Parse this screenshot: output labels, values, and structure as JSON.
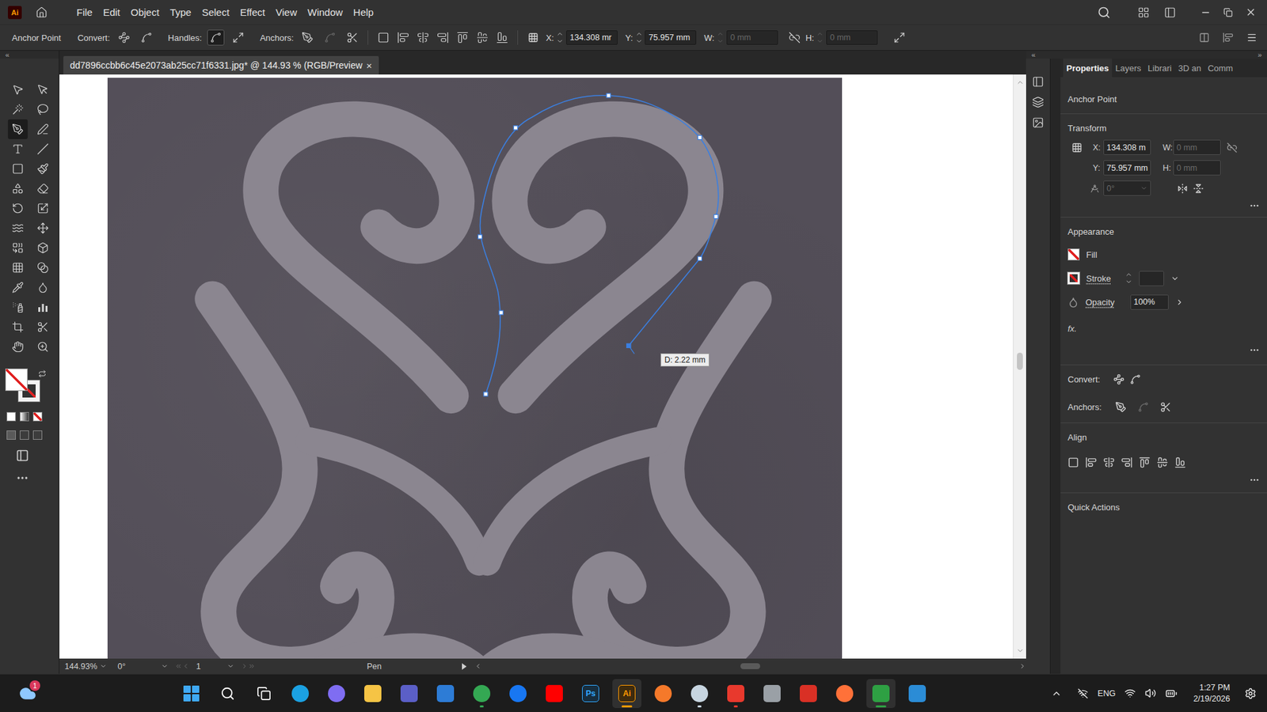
{
  "app": {
    "logo": "Ai"
  },
  "menu": [
    "File",
    "Edit",
    "Object",
    "Type",
    "Select",
    "Effect",
    "View",
    "Window",
    "Help"
  ],
  "control_bar": {
    "tool_name": "Anchor Point",
    "convert_label": "Convert:",
    "handles_label": "Handles:",
    "anchors_label": "Anchors:",
    "handles": [
      {
        "selected": true
      },
      {
        "selected": false
      }
    ],
    "anchor_buttons": [
      {
        "disabled": false
      },
      {
        "disabled": true
      },
      {
        "disabled": false
      }
    ],
    "fields": [
      {
        "label": "X:",
        "value": "134.308 mr",
        "disabled": false
      },
      {
        "label": "Y:",
        "value": "75.957 mm",
        "disabled": false
      },
      {
        "label": "W:",
        "value": "0 mm",
        "disabled": true
      },
      {
        "label": "H:",
        "value": "0 mm",
        "disabled": true
      }
    ]
  },
  "panel_toggles": {
    "toolbar_collapse": "«",
    "panels_collapse": "«",
    "panels_expand": "»"
  },
  "toolbar": {
    "tools": [
      {
        "selected": false
      },
      {
        "selected": false
      },
      {
        "selected": false
      },
      {
        "selected": false
      },
      {
        "selected": true
      },
      {
        "selected": false
      },
      {
        "selected": false
      },
      {
        "selected": false
      },
      {
        "selected": false
      },
      {
        "selected": false
      },
      {
        "selected": false
      },
      {
        "selected": false
      },
      {
        "selected": false
      },
      {
        "selected": false
      },
      {
        "selected": false
      },
      {
        "selected": false
      },
      {
        "selected": false
      },
      {
        "selected": false
      },
      {
        "selected": false
      },
      {
        "selected": false
      },
      {
        "selected": false
      },
      {
        "selected": false
      },
      {
        "selected": false
      },
      {
        "selected": false
      },
      {
        "selected": false
      },
      {
        "selected": false
      },
      {
        "selected": false
      },
      {
        "selected": false
      }
    ]
  },
  "document": {
    "tab_title": "dd7896ccbb6c45e2073ab25cc71f6331.jpg* @ 144.93 % (RGB/Preview",
    "close": "×",
    "measure_tooltip": "D: 2.22 mm",
    "h_scroll_level": 0.5,
    "v_scroll_level": 0.49
  },
  "panel_tabs": [
    {
      "label": "Properties",
      "selected": true
    },
    {
      "label": "Layers",
      "selected": false
    },
    {
      "label": "Librari",
      "selected": false
    },
    {
      "label": "3D an",
      "selected": false
    },
    {
      "label": "Comm",
      "selected": false
    }
  ],
  "properties": {
    "selection": "Anchor Point",
    "transform": {
      "title": "Transform",
      "fields": [
        {
          "label": "X:",
          "value": "134.308 m",
          "disabled": false
        },
        {
          "label": "W:",
          "value": "0 mm",
          "disabled": true
        },
        {
          "label": "Y:",
          "value": "75.957 mm",
          "disabled": false
        },
        {
          "label": "H:",
          "value": "0 mm",
          "disabled": true
        }
      ],
      "angle": {
        "value": "0°",
        "disabled": true
      }
    },
    "appearance": {
      "title": "Appearance",
      "fill": "Fill",
      "stroke": "Stroke",
      "opacity_label": "Opacity",
      "opacity_value": "100%",
      "effects": "fx."
    },
    "convert_label": "Convert:",
    "anchors_label": "Anchors:",
    "anchor_buttons": [
      {
        "disabled": false
      },
      {
        "disabled": true
      },
      {
        "disabled": false
      }
    ],
    "align_title": "Align",
    "quick_actions_title": "Quick Actions"
  },
  "status_bar": {
    "zoom": "144.93%",
    "rotation": "0°",
    "artboard": "1",
    "tool": "Pen"
  },
  "taskbar": {
    "weather_badge": "1",
    "apps": [
      {
        "kind": "windows",
        "color": "#3fa9f5",
        "label": "",
        "selected": false,
        "running": false
      },
      {
        "kind": "search",
        "color": "#ffffff",
        "label": "",
        "selected": false,
        "running": false
      },
      {
        "kind": "taskview",
        "color": "#ffffff",
        "label": "",
        "selected": false,
        "running": false
      },
      {
        "kind": "circle",
        "color": "#1ba1e2",
        "label": "",
        "selected": false,
        "running": false
      },
      {
        "kind": "circle",
        "color": "#7f6df2",
        "label": "",
        "selected": false,
        "running": false
      },
      {
        "kind": "tile",
        "color": "#f6c445",
        "label": "",
        "selected": false,
        "running": false
      },
      {
        "kind": "tile",
        "color": "#5b5fc7",
        "label": "",
        "selected": false,
        "running": false
      },
      {
        "kind": "tile",
        "color": "#2d7cd6",
        "label": "",
        "selected": false,
        "running": false
      },
      {
        "kind": "circle",
        "color": "#34a853",
        "label": "",
        "selected": false,
        "running": true
      },
      {
        "kind": "circle",
        "color": "#1877f2",
        "label": "",
        "selected": false,
        "running": false
      },
      {
        "kind": "tile",
        "color": "#ff0000",
        "label": "",
        "selected": false,
        "running": false
      },
      {
        "kind": "tile",
        "color": "#31a8ff",
        "label": "Ps",
        "selected": false,
        "running": false
      },
      {
        "kind": "tile",
        "color": "#ff9a00",
        "label": "Ai",
        "selected": true,
        "running": true
      },
      {
        "kind": "circle",
        "color": "#f5792a",
        "label": "",
        "selected": false,
        "running": false
      },
      {
        "kind": "circle",
        "color": "#c7d5e0",
        "label": "",
        "selected": false,
        "running": true
      },
      {
        "kind": "tile",
        "color": "#e8392d",
        "label": "",
        "selected": false,
        "running": true
      },
      {
        "kind": "tile",
        "color": "#9aa0a6",
        "label": "",
        "selected": false,
        "running": false
      },
      {
        "kind": "tile",
        "color": "#d93025",
        "label": "",
        "selected": false,
        "running": false
      },
      {
        "kind": "circle",
        "color": "#ff7139",
        "label": "",
        "selected": false,
        "running": false
      },
      {
        "kind": "tile",
        "color": "#2ea043",
        "label": "",
        "selected": true,
        "running": true
      },
      {
        "kind": "tile",
        "color": "#2b8cd6",
        "label": "",
        "selected": false,
        "running": false
      }
    ],
    "language": "ENG",
    "time": "1:27 PM",
    "date": "2/19/2026"
  }
}
